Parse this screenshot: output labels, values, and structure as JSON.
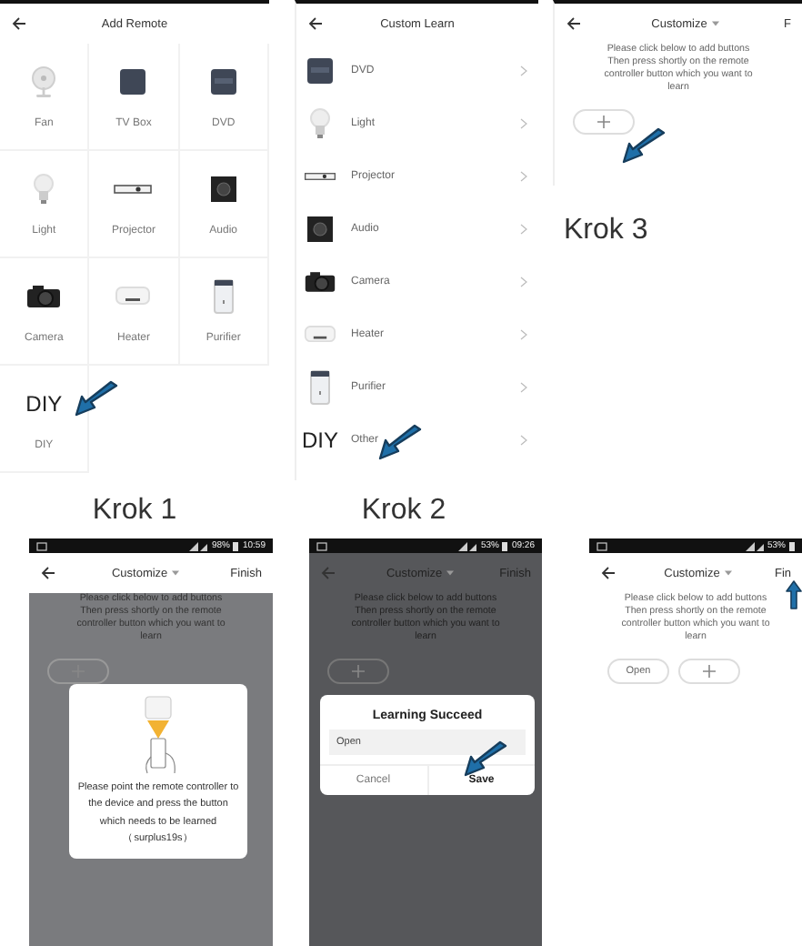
{
  "panels": [
    {
      "kind": "grid",
      "title": "Add Remote",
      "caption": "Krok 1",
      "items": [
        {
          "kind": "fan",
          "label": "Fan",
          "pointed": false
        },
        {
          "kind": "tvbox",
          "label": "TV Box",
          "pointed": false
        },
        {
          "kind": "dvd",
          "label": "DVD",
          "pointed": false
        },
        {
          "kind": "bulb",
          "label": "Light",
          "pointed": false
        },
        {
          "kind": "projector",
          "label": "Projector",
          "pointed": false
        },
        {
          "kind": "audio",
          "label": "Audio",
          "pointed": false
        },
        {
          "kind": "camera",
          "label": "Camera",
          "pointed": false
        },
        {
          "kind": "heater",
          "label": "Heater",
          "pointed": false
        },
        {
          "kind": "purifier",
          "label": "Purifier",
          "pointed": false
        },
        {
          "kind": "text",
          "icon_text": "DIY",
          "label": "DIY",
          "pointed": true
        }
      ]
    },
    {
      "kind": "list",
      "title": "Custom Learn",
      "caption": "Krok 2",
      "items": [
        {
          "kind": "dvd",
          "label": "DVD",
          "pointed": false
        },
        {
          "kind": "bulb",
          "label": "Light",
          "pointed": false
        },
        {
          "kind": "projector",
          "label": "Projector",
          "pointed": false
        },
        {
          "kind": "audio",
          "label": "Audio",
          "pointed": false
        },
        {
          "kind": "camera",
          "label": "Camera",
          "pointed": false
        },
        {
          "kind": "heater",
          "label": "Heater",
          "pointed": false
        },
        {
          "kind": "purifier",
          "label": "Purifier",
          "pointed": false
        },
        {
          "kind": "text",
          "icon_text": "DIY",
          "label": "Other",
          "pointed": true
        }
      ]
    },
    {
      "kind": "customize",
      "title": "Customize",
      "action": "F",
      "caption": "Krok 3",
      "instructions": "Please click below to add buttons Then press shortly on the remote controller button which you want to learn",
      "add_pointed": true
    },
    {
      "kind": "customize",
      "status": {
        "battery": "98%",
        "time": "10:59"
      },
      "title": "Customize",
      "action": "Finish",
      "instructions": "Please click below to add buttons Then press shortly on the remote controller button which you want to learn",
      "dialog": {
        "kind": "pointing",
        "text": "Please point the remote controller to the device and press the button which needs to be learned（surplus19s）"
      }
    },
    {
      "kind": "customize",
      "status": {
        "battery": "53%",
        "time": "09:26"
      },
      "title": "Customize",
      "action": "Finish",
      "instructions": "Please click below to add buttons Then press shortly on the remote controller button which you want to learn",
      "dialog": {
        "kind": "learned",
        "title": "Learning Succeed",
        "value": "Open",
        "cancel": "Cancel",
        "save": "Save",
        "save_pointed": true
      }
    },
    {
      "kind": "customize",
      "status": {
        "battery": "53%"
      },
      "title": "Customize",
      "action": "Fin",
      "action_pointed": true,
      "instructions": "Please click below to add buttons Then press shortly on the remote controller button which you want to learn",
      "buttons": [
        {
          "label": "Open"
        }
      ]
    }
  ]
}
